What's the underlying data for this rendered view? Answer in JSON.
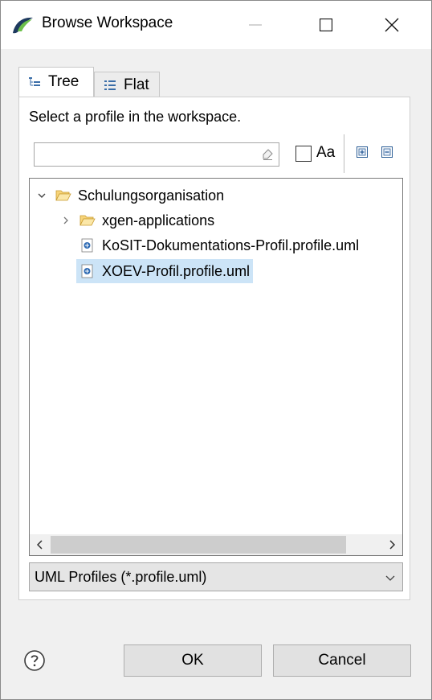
{
  "window": {
    "title": "Browse Workspace",
    "icons": {
      "app": "eclipse-leaf-icon",
      "minimize": "minimize-icon",
      "maximize": "maximize-icon",
      "close": "close-icon"
    }
  },
  "tabs": [
    {
      "label": "Tree",
      "icon": "tree-view-icon",
      "active": true
    },
    {
      "label": "Flat",
      "icon": "flat-list-icon",
      "active": false
    }
  ],
  "panel": {
    "description": "Select a profile in the workspace.",
    "filter": {
      "value": "",
      "placeholder": ""
    },
    "match_case_label": "Aa",
    "match_case_checked": false
  },
  "tree": {
    "items": [
      {
        "label": "Schulungsorganisation",
        "type": "folder-open",
        "expanded": true,
        "level": 0
      },
      {
        "label": "xgen-applications",
        "type": "folder",
        "expanded": false,
        "level": 1
      },
      {
        "label": "KoSIT-Dokumentations-Profil.profile.uml",
        "type": "uml-file",
        "level": 1
      },
      {
        "label": "XOEV-Profil.profile.uml",
        "type": "uml-file",
        "level": 1,
        "selected": true
      }
    ]
  },
  "file_type": {
    "selected": "UML Profiles (*.profile.uml)"
  },
  "buttons": {
    "ok": "OK",
    "cancel": "Cancel",
    "help_icon": "help-icon"
  },
  "colors": {
    "selection": "#cce4f7",
    "accent_blue": "#1a5fb4",
    "folder": "#e8b84a"
  }
}
